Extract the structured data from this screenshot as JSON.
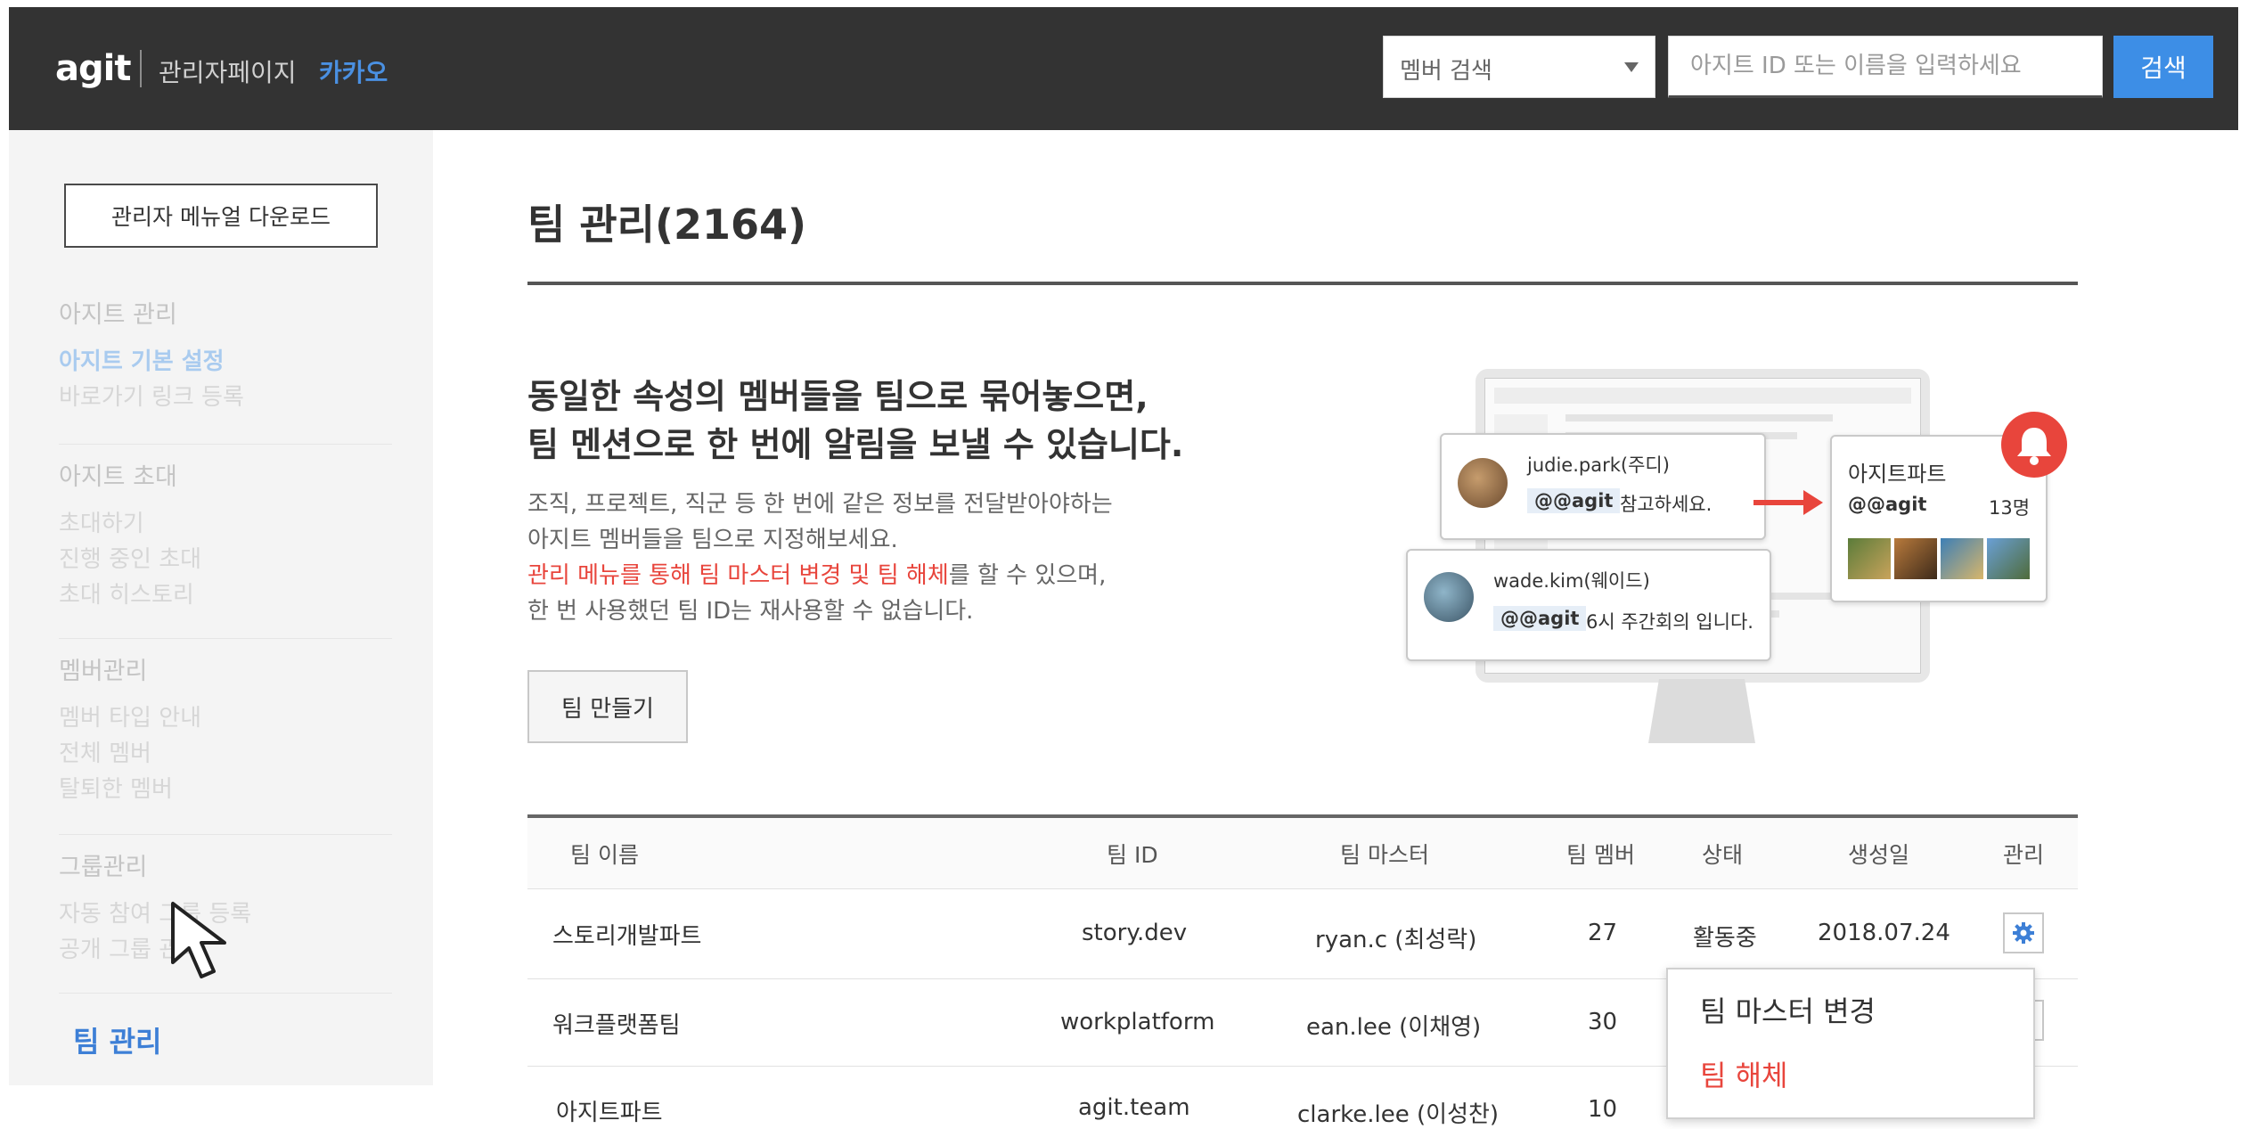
{
  "header": {
    "logo": "agit",
    "admin_label": "관리자페이지",
    "company": "카카오",
    "search_select": "멤버 검색",
    "search_placeholder": "아지트 ID 또는 이름을 입력하세요",
    "search_button": "검색"
  },
  "sidebar": {
    "manual_button": "관리자 메뉴얼 다운로드",
    "groups": [
      {
        "heading": "아지트 관리",
        "items": [
          "아지트 기본 설정",
          "바로가기 링크 등록"
        ]
      },
      {
        "heading": "아지트 초대",
        "items": [
          "초대하기",
          "진행 중인 초대",
          "초대 히스토리"
        ]
      },
      {
        "heading": "멤버관리",
        "items": [
          "멤버 타입 안내",
          "전체 멤버",
          "탈퇴한 멤버"
        ]
      },
      {
        "heading": "그룹관리",
        "items": [
          "자동 참여 그룹 등록",
          "공개 그룹 관리"
        ]
      }
    ],
    "current": "팀 관리"
  },
  "main": {
    "title": "팀 관리(2164)",
    "intro_line1": "동일한 속성의 멤버들을 팀으로 묶어놓으면,",
    "intro_line2": "팀 멘션으로 한 번에 알림을 보낼 수 있습니다.",
    "desc_line1": "조직, 프로젝트, 직군 등 한 번에 같은 정보를 전달받아야하는",
    "desc_line2": "아지트 멤버들을 팀으로 지정해보세요.",
    "desc_highlight": "관리 메뉴를 통해 팀 마스터 변경 및 팀 해체",
    "desc_line3_rest": "를 할 수 있으며,",
    "desc_line4": "한 번 사용했던 팀 ID는 재사용할 수 없습니다.",
    "create_button": "팀 만들기"
  },
  "illustration": {
    "bubble1_name": "judie.park(주디)",
    "bubble1_tag": "@@agit",
    "bubble1_msg": "참고하세요.",
    "bubble2_name": "wade.kim(웨이드)",
    "bubble2_tag": "@@agit",
    "bubble2_msg": "6시 주간회의 입니다.",
    "card_title": "아지트파트",
    "card_tag": "@@agit",
    "card_count": "13명",
    "accent_color": "#e8453c"
  },
  "table": {
    "headers": [
      "팀 이름",
      "팀 ID",
      "팀 마스터",
      "팀 멤버",
      "상태",
      "생성일",
      "관리"
    ],
    "rows": [
      {
        "name": "스토리개발파트",
        "id": "story.dev",
        "master": "ryan.c (최성락)",
        "members": "27",
        "status": "활동중",
        "created": "2018.07.24"
      },
      {
        "name": "워크플랫폼팀",
        "id": "workplatform",
        "master": "ean.lee (이채영)",
        "members": "30"
      },
      {
        "name": "아지트파트",
        "id": "agit.team",
        "master": "clarke.lee (이성찬)",
        "members": "10"
      }
    ]
  },
  "dropdown": {
    "change_master": "팀 마스터 변경",
    "dissolve": "팀 해체"
  }
}
